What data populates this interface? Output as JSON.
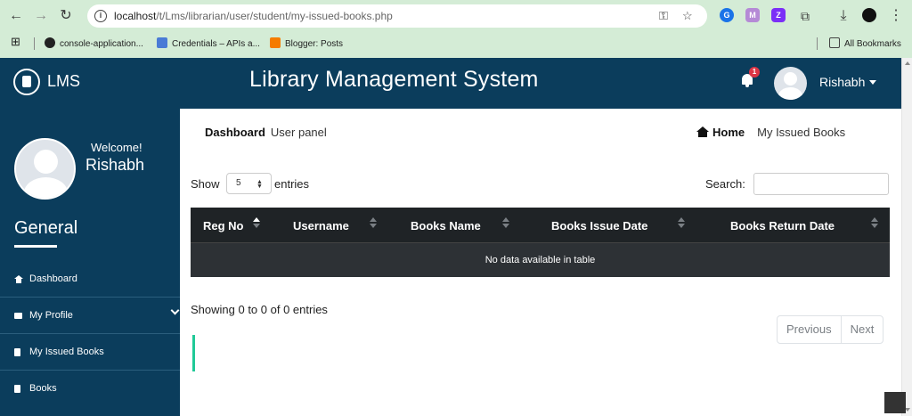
{
  "browser": {
    "url_host": "localhost",
    "url_path": "/t/Lms/librarian/user/student/my-issued-books.php",
    "bookmarks": [
      {
        "label": "console-application..."
      },
      {
        "label": "Credentials – APIs a..."
      },
      {
        "label": "Blogger: Posts"
      }
    ],
    "all_bookmarks": "All Bookmarks"
  },
  "header": {
    "logo_text": "LMS",
    "title": "Library Management System",
    "notification_count": "1",
    "user_name": "Rishabh"
  },
  "sidebar": {
    "welcome": "Welcome!",
    "user_name": "Rishabh",
    "section_title": "General",
    "items": [
      {
        "label": "Dashboard",
        "icon": "home-icon"
      },
      {
        "label": "My Profile",
        "icon": "id-card-icon"
      },
      {
        "label": "My Issued Books",
        "icon": "book-icon"
      },
      {
        "label": "Books",
        "icon": "book-icon"
      }
    ]
  },
  "breadcrumb": {
    "title": "Dashboard",
    "subtitle": "User panel",
    "home": "Home",
    "current": "My Issued Books"
  },
  "table_controls": {
    "show_label": "Show",
    "entries_value": "5",
    "entries_label": "entries",
    "search_label": "Search:"
  },
  "table": {
    "columns": [
      "Reg No",
      "Username",
      "Books Name",
      "Books Issue Date",
      "Books Return Date"
    ],
    "empty_message": "No data available in table"
  },
  "footer": {
    "info": "Showing 0 to 0 of 0 entries",
    "previous": "Previous",
    "next": "Next"
  },
  "colors": {
    "brand": "#0b3d5c",
    "table_header": "#1f2326",
    "accent": "#20c997",
    "badge": "#dc3545"
  }
}
